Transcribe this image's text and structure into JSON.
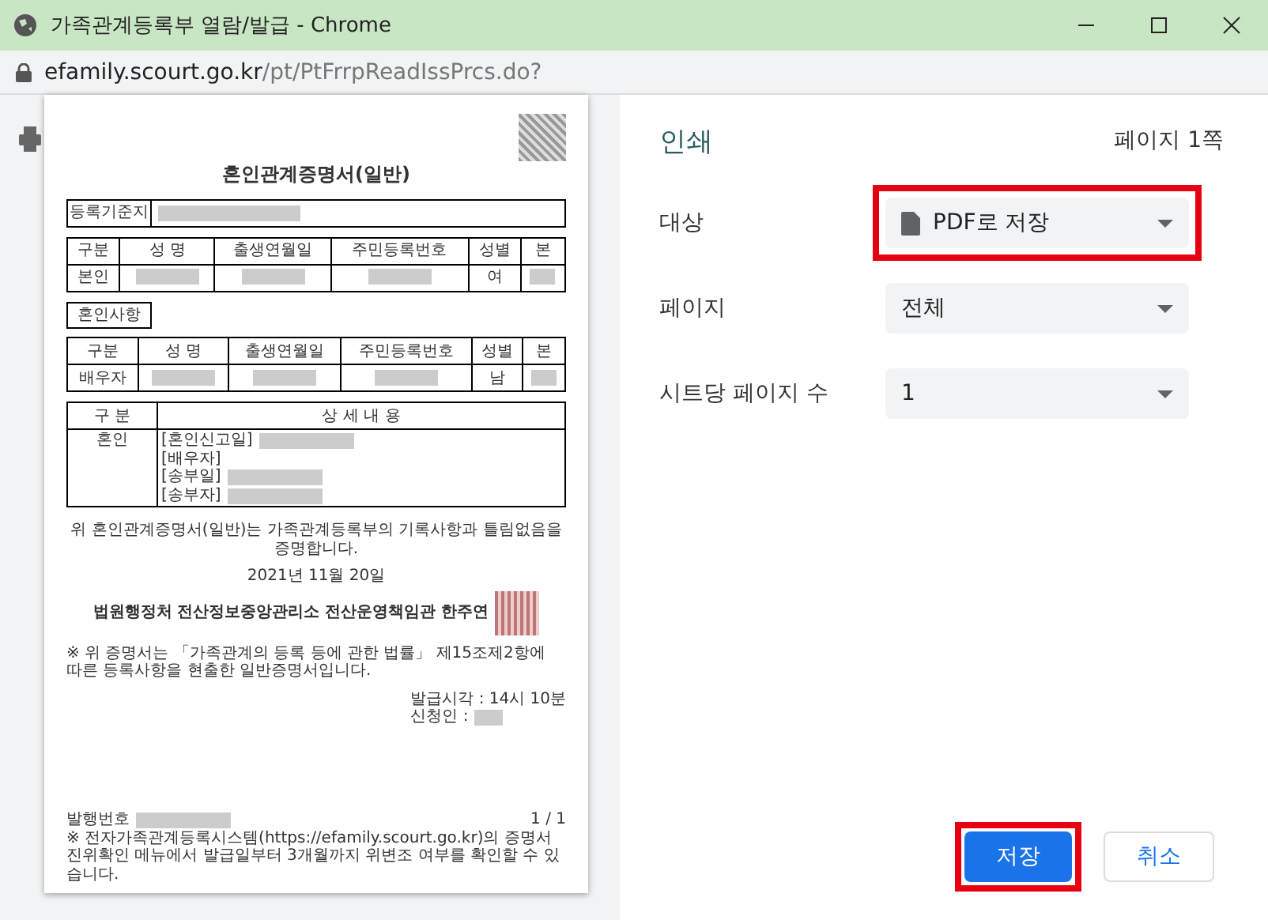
{
  "window": {
    "title": "가족관계등록부 열람/발급 - Chrome"
  },
  "address_bar": {
    "host": "efamily.scourt.go.kr",
    "path": "/pt/PtFrrpReadIssPrcs.do?"
  },
  "document": {
    "title": "혼인관계증명서(일반)",
    "registration": {
      "label": "등록기준지"
    },
    "person_table": {
      "columns": [
        "구분",
        "성 명",
        "출생연월일",
        "주민등록번호",
        "성별",
        "본"
      ],
      "rows": [
        {
          "cells": [
            {
              "kind": "text",
              "text": "본인"
            },
            {
              "kind": "redacted"
            },
            {
              "kind": "redacted"
            },
            {
              "kind": "redacted"
            },
            {
              "kind": "text",
              "text": "여"
            },
            {
              "kind": "redacted"
            }
          ]
        }
      ]
    },
    "section_label": "혼인사항",
    "spouse_table": {
      "columns": [
        "구분",
        "성 명",
        "출생연월일",
        "주민등록번호",
        "성별",
        "본"
      ],
      "rows": [
        {
          "cells": [
            {
              "kind": "text",
              "text": "배우자"
            },
            {
              "kind": "redacted"
            },
            {
              "kind": "redacted"
            },
            {
              "kind": "redacted"
            },
            {
              "kind": "text",
              "text": "남"
            },
            {
              "kind": "redacted"
            }
          ]
        }
      ]
    },
    "detail_table": {
      "columns": [
        "구 분",
        "상 세 내 용"
      ],
      "row_label": "혼인",
      "items": [
        {
          "text": "[혼인신고일]",
          "redacted": true
        },
        {
          "text": "[배우자]",
          "redacted": false
        },
        {
          "text": "[송부일]",
          "redacted": true
        },
        {
          "text": "[송부자]",
          "redacted": true
        }
      ]
    },
    "certification": "위 혼인관계증명서(일반)는 가족관계등록부의 기록사항과 틀림없음을 증명합니다.",
    "date": "2021년 11월 20일",
    "issuer": "법원행정처 전산정보중앙관리소 전산운영책임관 한주연",
    "note": "※ 위 증명서는 「가족관계의 등록 등에 관한 법률」 제15조제2항에 따른 등록사항을 현출한 일반증명서입니다.",
    "issue_time": "발급시각 : 14시 10분",
    "applicant": "신청인 :",
    "serial_label": "발행번호",
    "page_number": "1 / 1",
    "footer_note": "※ 전자가족관계등록시스템(https://efamily.scourt.go.kr)의 증명서 진위확인 메뉴에서 발급일부터 3개월까지 위변조 여부를 확인할 수 있습니다."
  },
  "print_panel": {
    "title": "인쇄",
    "page_count": "페이지 1쪽",
    "settings": [
      {
        "kind": "destination",
        "label": "대상",
        "value": "PDF로 저장",
        "highlighted": true
      },
      {
        "kind": "select",
        "label": "페이지",
        "value": "전체",
        "highlighted": false
      },
      {
        "kind": "select",
        "label": "시트당 페이지 수",
        "value": "1",
        "highlighted": false
      }
    ],
    "buttons": [
      {
        "kind": "primary",
        "label": "저장",
        "highlighted": true
      },
      {
        "kind": "secondary",
        "label": "취소",
        "highlighted": false
      }
    ]
  }
}
